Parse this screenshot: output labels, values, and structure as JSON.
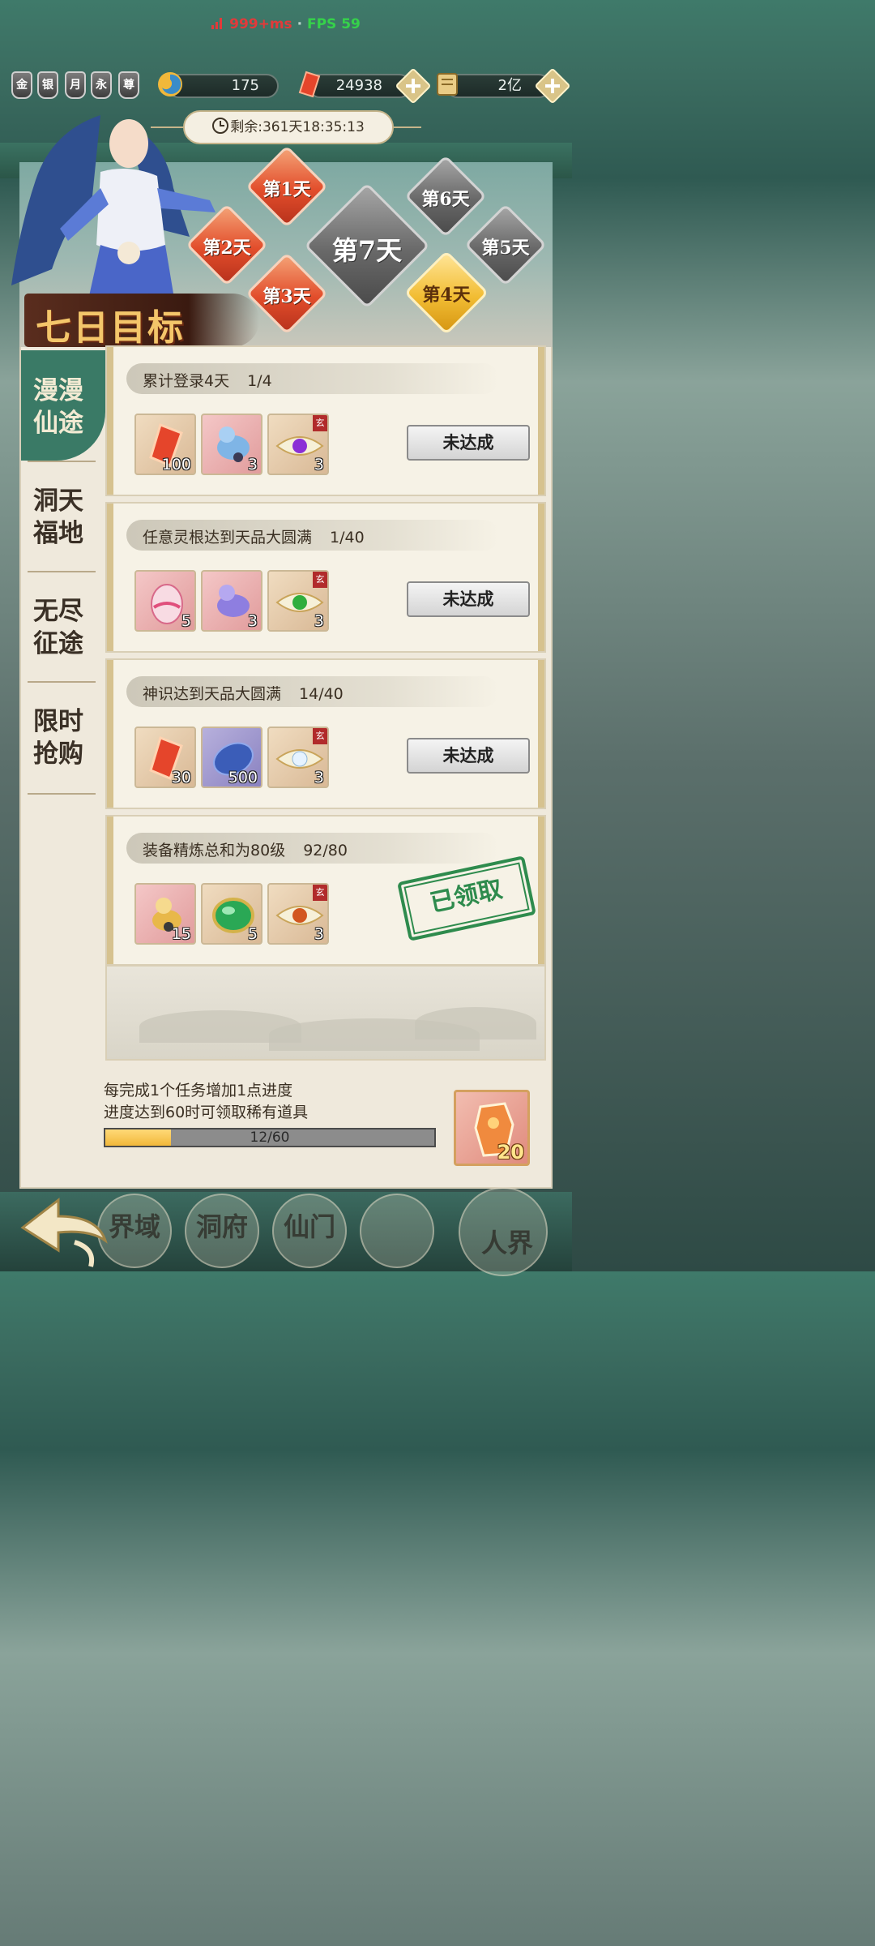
{
  "status_bar": {
    "ping": "999+ms",
    "separator": "·",
    "fps": "FPS 59",
    "ping_color": "#e23a3a",
    "fps_color": "#35d24a"
  },
  "top_bar": {
    "rank_icons": [
      "金",
      "银",
      "月",
      "永",
      "尊"
    ],
    "spirit_currency": "175",
    "crystal_currency": "24938",
    "scroll_currency": "2亿"
  },
  "timer": {
    "text": "剩余:361天18:35:13"
  },
  "title": "七日目标",
  "days": [
    {
      "label": "第1天",
      "style": "red"
    },
    {
      "label": "第2天",
      "style": "red"
    },
    {
      "label": "第3天",
      "style": "red"
    },
    {
      "label": "第4天",
      "style": "gold"
    },
    {
      "label": "第5天",
      "style": "gray"
    },
    {
      "label": "第6天",
      "style": "gray"
    },
    {
      "label": "第7天",
      "style": "gray"
    }
  ],
  "tabs": [
    {
      "label": "漫漫仙途",
      "active": true
    },
    {
      "label": "洞天福地",
      "active": false
    },
    {
      "label": "无尽征途",
      "active": false
    },
    {
      "label": "限时抢购",
      "active": false
    }
  ],
  "tasks": [
    {
      "title": "累计登录4天",
      "progress": "1/4",
      "rewards": [
        {
          "icon": "red-crystal-icon",
          "qty": "100"
        },
        {
          "icon": "blue-spirit-pet-icon",
          "qty": "3"
        },
        {
          "icon": "purple-orb-scroll-icon",
          "qty": "3",
          "badge": "玄"
        }
      ],
      "status": "未达成"
    },
    {
      "title": "任意灵根达到天品大圆满",
      "progress": "1/40",
      "rewards": [
        {
          "icon": "pink-egg-icon",
          "qty": "5"
        },
        {
          "icon": "purple-spirit-pet-icon",
          "qty": "3"
        },
        {
          "icon": "green-orb-scroll-icon",
          "qty": "3",
          "badge": "玄"
        }
      ],
      "status": "未达成"
    },
    {
      "title": "神识达到天品大圆满",
      "progress": "14/40",
      "rewards": [
        {
          "icon": "red-crystal-icon",
          "qty": "30"
        },
        {
          "icon": "blue-stone-icon",
          "qty": "500"
        },
        {
          "icon": "white-orb-scroll-icon",
          "qty": "3",
          "badge": "玄"
        }
      ],
      "status": "未达成"
    },
    {
      "title": "装备精炼总和为80级",
      "progress": "92/80",
      "rewards": [
        {
          "icon": "gold-spirit-pet-icon",
          "qty": "15"
        },
        {
          "icon": "jade-gem-icon",
          "qty": "5"
        },
        {
          "icon": "orange-orb-scroll-icon",
          "qty": "3",
          "badge": "玄"
        }
      ],
      "status": "已领取"
    }
  ],
  "footer": {
    "line1": "每完成1个任务增加1点进度",
    "line2": "进度达到60时可领取稀有道具",
    "progress_text": "12/60",
    "progress_fraction": 0.2,
    "reward_qty": "20"
  },
  "bottom_nav": {
    "items": [
      "界域",
      "洞府",
      "仙门",
      "人界"
    ]
  }
}
